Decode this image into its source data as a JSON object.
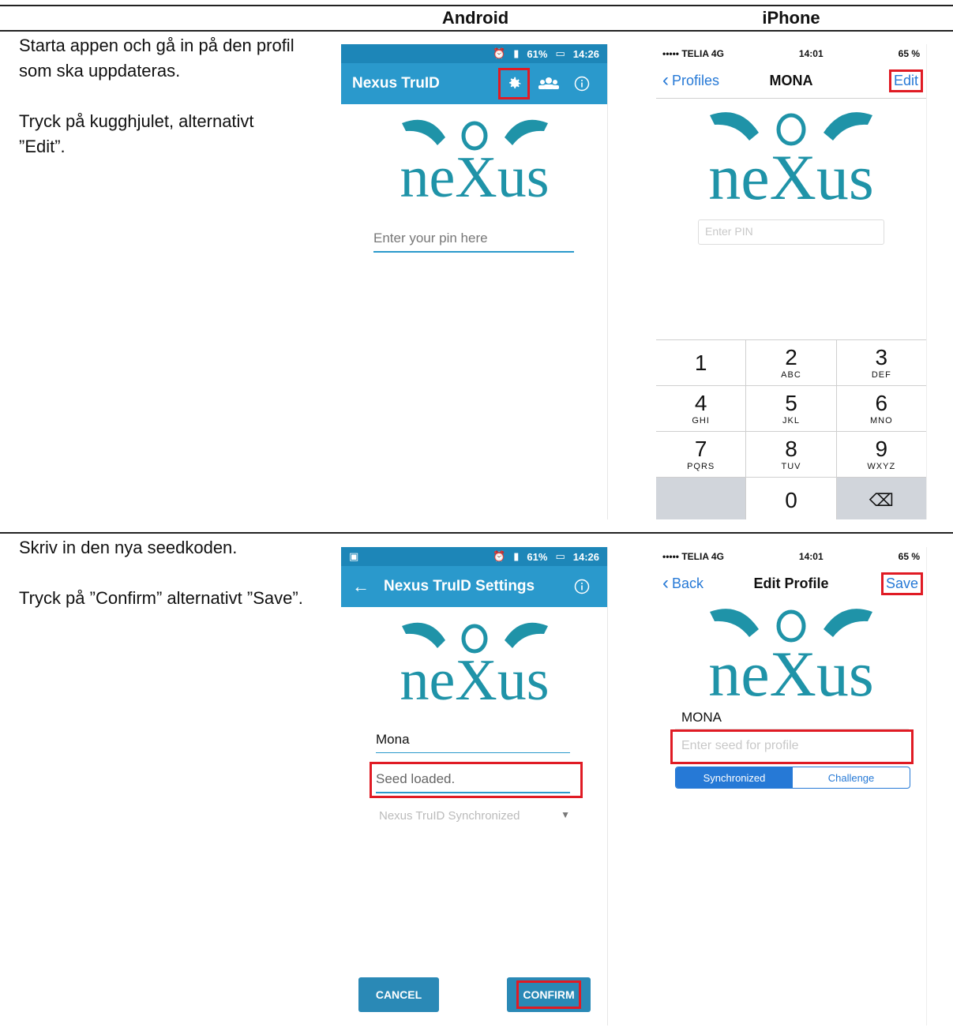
{
  "columns": {
    "android": "Android",
    "iphone": "iPhone"
  },
  "step1": {
    "text1": "Starta appen och gå in på den profil som ska uppdateras.",
    "text2": "Tryck på kugghjulet, alternativt ”Edit”."
  },
  "step2": {
    "text1": "Skriv in den nya seedkoden.",
    "text2": "Tryck på ”Confirm” alternativt ”Save”."
  },
  "logo_text": "neXus",
  "android1": {
    "status_battery": "61%",
    "status_time": "14:26",
    "title": "Nexus TruID",
    "pin_placeholder": "Enter your pin here",
    "icons": [
      "gear-icon",
      "profiles-icon",
      "info-icon"
    ]
  },
  "iphone1": {
    "carrier": "••••• TELIA  4G",
    "time": "14:01",
    "battery": "65 %",
    "back_label": "Profiles",
    "title": "MONA",
    "right_label": "Edit",
    "pin_placeholder": "Enter PIN",
    "keys": [
      [
        {
          "d": "1",
          "l": ""
        },
        {
          "d": "2",
          "l": "ABC"
        },
        {
          "d": "3",
          "l": "DEF"
        }
      ],
      [
        {
          "d": "4",
          "l": "GHI"
        },
        {
          "d": "5",
          "l": "JKL"
        },
        {
          "d": "6",
          "l": "MNO"
        }
      ],
      [
        {
          "d": "7",
          "l": "PQRS"
        },
        {
          "d": "8",
          "l": "TUV"
        },
        {
          "d": "9",
          "l": "WXYZ"
        }
      ],
      [
        {
          "d": "",
          "l": ""
        },
        {
          "d": "0",
          "l": ""
        },
        {
          "d": "⌫",
          "l": ""
        }
      ]
    ]
  },
  "android2": {
    "status_battery": "61%",
    "status_time": "14:26",
    "title": "Nexus TruID Settings",
    "name_value": "Mona",
    "seed_value": "Seed loaded.",
    "mode_value": "Nexus TruID Synchronized",
    "cancel_label": "CANCEL",
    "confirm_label": "CONFIRM"
  },
  "iphone2": {
    "carrier": "••••• TELIA  4G",
    "time": "14:01",
    "battery": "65 %",
    "back_label": "Back",
    "title": "Edit Profile",
    "right_label": "Save",
    "name_value": "MONA",
    "seed_placeholder": "Enter seed for profile",
    "seg_selected": "Synchronized",
    "seg_other": "Challenge"
  },
  "colors": {
    "android_toolbar": "#2a99cc",
    "ios_blue": "#2679d6",
    "highlight": "#e01b24",
    "logo": "#1f93a8"
  }
}
